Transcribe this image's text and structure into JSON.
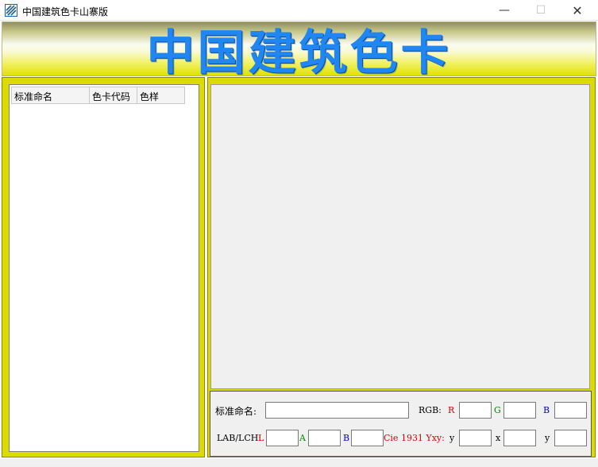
{
  "window": {
    "title": "中国建筑色卡山寨版",
    "icon": "app-logo-icon",
    "minimize_glyph": "—",
    "maximize_glyph": "☐",
    "close_glyph": "✕"
  },
  "banner": {
    "title": "中国建筑色卡"
  },
  "list": {
    "columns": [
      "标准命名",
      "色卡代码",
      "色样"
    ],
    "rows": []
  },
  "info": {
    "name_label": "标准命名:",
    "name_value": "",
    "rgb_label": "RGB:",
    "r_label": "R",
    "g_label": "G",
    "b_label": "B",
    "r_value": "",
    "g_value": "",
    "b_value": "",
    "lab_label": "LAB/LCH:",
    "l_label": "L",
    "a_label": "A",
    "lab_b_label": "B",
    "l_value": "",
    "a_value": "",
    "lab_b_value": "",
    "cie_label": "Cie 1931 Yxy:",
    "cy_label": "y",
    "cx_label": "x",
    "cy2_label": "y",
    "cy_value": "",
    "cx_value": "",
    "cy2_value": ""
  },
  "colors": {
    "panel_yellow": "#dbdb00",
    "title_blue": "#1f86f2",
    "label_red": "#e00000",
    "label_green": "#008c00",
    "label_blue": "#0000d0"
  }
}
